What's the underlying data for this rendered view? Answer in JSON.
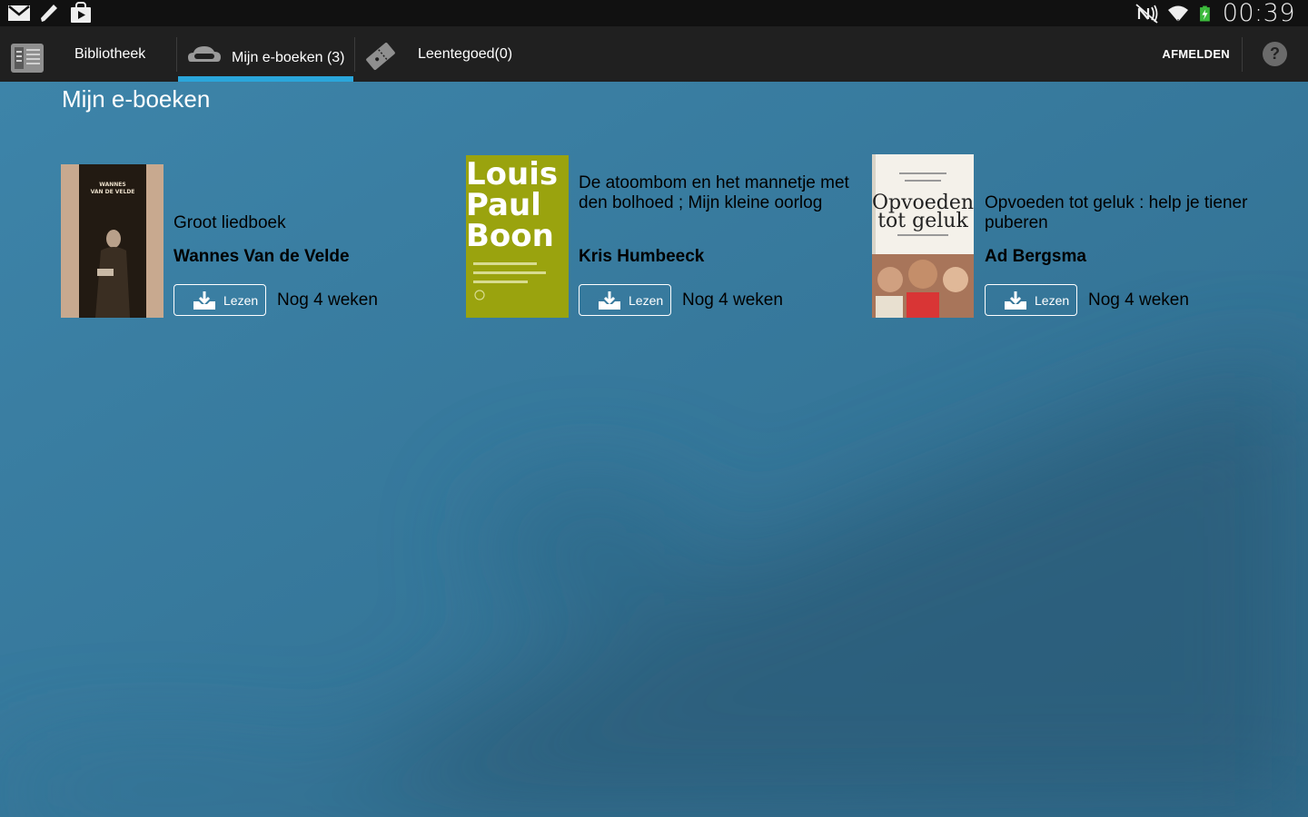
{
  "status_bar": {
    "time": "00:39",
    "left_icons": [
      "mail-icon",
      "pencil-icon",
      "shopping-bag-icon"
    ],
    "right_icons": [
      "nfc-icon",
      "wifi-icon",
      "battery-charging-icon"
    ]
  },
  "action_bar": {
    "tabs": [
      {
        "label": "Bibliotheek",
        "icon": "library-icon",
        "selected": false
      },
      {
        "label": "Mijn e-boeken (3)",
        "icon": "cloud-icon",
        "selected": true
      },
      {
        "label": "Leentegoed(0)",
        "icon": "ticket-icon",
        "selected": false
      }
    ],
    "logout_label": "AFMELDEN",
    "help_label": "?",
    "accent": "#2aa6db"
  },
  "page": {
    "title": "Mijn e-boeken",
    "background": "#3a7fa3"
  },
  "books": [
    {
      "title": "Groot liedboek",
      "author": "Wannes Van de Velde",
      "read_label": "Lezen",
      "due": "Nog 4 weken",
      "cover_text": [
        "WANNES",
        "VAN DE VELDE"
      ]
    },
    {
      "title": "De atoombom en het mannetje met den bolhoed ; Mijn kleine oorlog",
      "author": "Kris Humbeeck",
      "read_label": "Lezen",
      "due": "Nog 4 weken",
      "cover_text": [
        "Louis",
        "Paul",
        "Boon"
      ],
      "cover_color": "#9aa30e"
    },
    {
      "title": "Opvoeden tot geluk : help je tiener puberen",
      "author": "Ad Bergsma",
      "read_label": "Lezen",
      "due": "Nog 4 weken",
      "cover_text": [
        "Opvoeden",
        "tot geluk"
      ]
    }
  ]
}
